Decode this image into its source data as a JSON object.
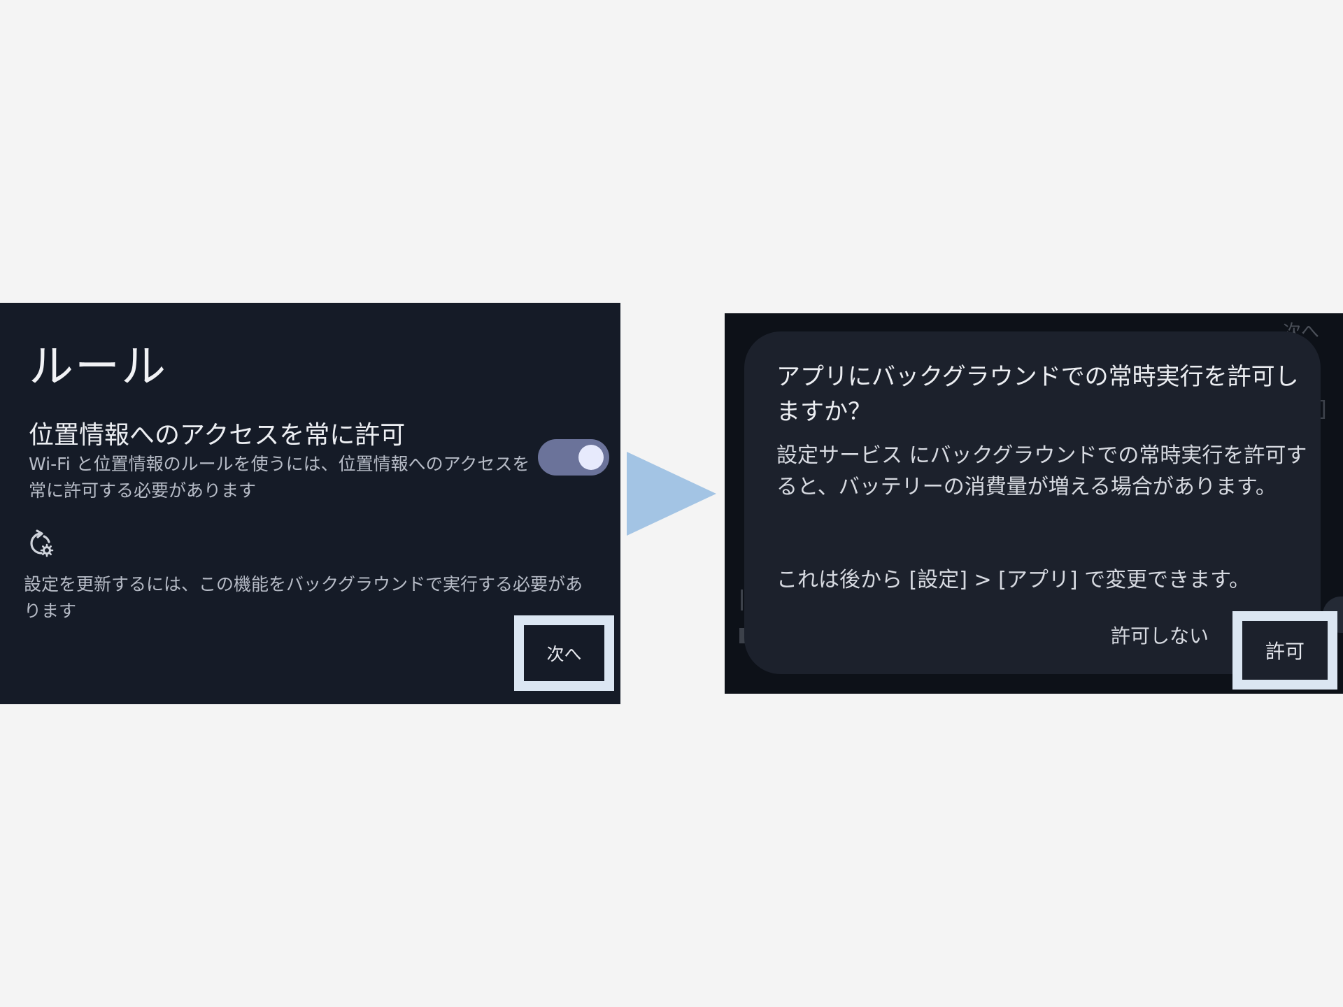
{
  "left": {
    "title": "ルール",
    "location_title": "位置情報へのアクセスを常に許可",
    "location_desc": "Wi-Fi と位置情報のルールを使うには、位置情報へのアクセスを常に許可する必要があります",
    "location_toggle_on": true,
    "background_desc": "設定を更新するには、この機能をバックグラウンドで実行する必要があります",
    "next_label": "次へ"
  },
  "right": {
    "background_next_label": "次へ",
    "dialog": {
      "title": "アプリにバックグラウンドでの常時実行を許可しますか？",
      "body": "設定サービス にバックグラウンドでの常時実行を許可すると、バッテリーの消費量が増える場合があります。",
      "note": "これは後から [設定] > [アプリ] で変更できます。",
      "deny_label": "許可しない",
      "allow_label": "許可"
    }
  },
  "colors": {
    "page_background": "#f4f4f4",
    "panel_background": "#151b27",
    "dialog_background": "#1c212c",
    "toggle_track": "#6b739a",
    "highlight_border": "#dbe6f2",
    "arrow": "#a3c4e4"
  },
  "icons": {
    "arrow": "arrow-right-icon",
    "sync_settings": "sync-settings-icon"
  }
}
